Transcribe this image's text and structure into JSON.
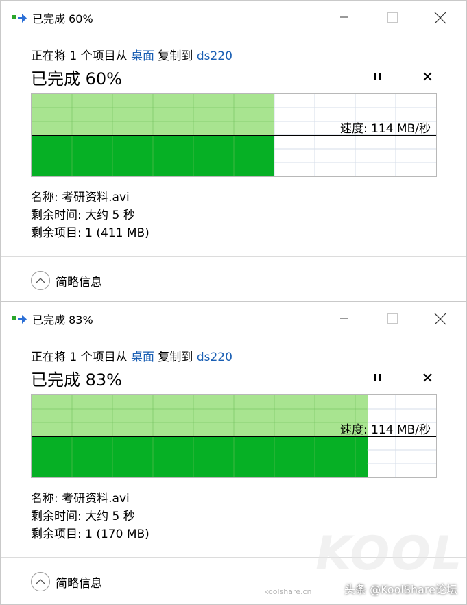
{
  "dialogs": [
    {
      "title": "已完成 60%",
      "subtitle": {
        "prefix": "正在将 1 个项目从 ",
        "source": "桌面",
        "middle": " 复制到 ",
        "dest": "ds220"
      },
      "heading": "已完成 60%",
      "progress": 0.6,
      "speed": "速度: 114 MB/秒",
      "name": "名称: 考研资料.avi",
      "time_remaining": "剩余时间: 大约 5 秒",
      "items_remaining": "剩余项目: 1 (411 MB)",
      "details_toggle": "简略信息"
    },
    {
      "title": "已完成 83%",
      "subtitle": {
        "prefix": "正在将 1 个项目从 ",
        "source": "桌面",
        "middle": " 复制到 ",
        "dest": "ds220"
      },
      "heading": "已完成 83%",
      "progress": 0.83,
      "speed": "速度: 114 MB/秒",
      "name": "名称: 考研资料.avi",
      "time_remaining": "剩余时间: 大约 5 秒",
      "items_remaining": "剩余项目: 1 (170 MB)",
      "details_toggle": "简略信息"
    }
  ],
  "watermark": {
    "text": "头条 @KoolShare论坛",
    "logo": "KOOL",
    "small": "koolshare.cn"
  },
  "colors": {
    "fill": "#06b025",
    "history": "#a8e490",
    "link": "#1a5fb4"
  },
  "icons": {
    "app": "copy-files-icon",
    "minimize": "minimize-icon",
    "maximize": "maximize-icon",
    "close": "close-icon",
    "pause": "pause-icon",
    "stop": "stop-icon",
    "toggle": "chevron-up-circle-icon"
  }
}
